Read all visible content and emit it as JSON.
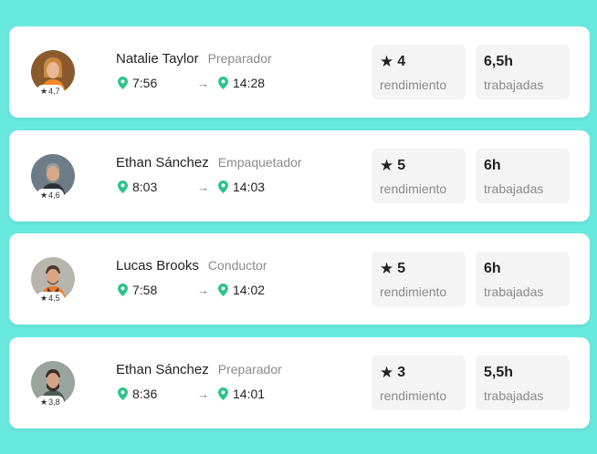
{
  "colors": {
    "background": "#69E8DE",
    "card": "#FFFFFF",
    "pin": "#2BC48A",
    "stat_bg": "#F4F4F4"
  },
  "icons": {
    "rating": "star-icon",
    "location": "map-pin-icon",
    "arrow": "arrow-right-icon"
  },
  "arrow_glyph": "→",
  "star_glyph": "★",
  "workers": [
    {
      "name": "Natalie Taylor",
      "role": "Preparador",
      "avatar_rating": "4,7",
      "start_time": "7:56",
      "end_time": "14:28",
      "performance": "4",
      "performance_label": "rendimiento",
      "hours": "6,5h",
      "hours_label": "trabajadas"
    },
    {
      "name": "Ethan Sánchez",
      "role": "Empaquetador",
      "avatar_rating": "4,6",
      "start_time": "8:03",
      "end_time": "14:03",
      "performance": "5",
      "performance_label": "rendimiento",
      "hours": "6h",
      "hours_label": "trabajadas"
    },
    {
      "name": "Lucas Brooks",
      "role": "Conductor",
      "avatar_rating": "4,5",
      "start_time": "7:58",
      "end_time": "14:02",
      "performance": "5",
      "performance_label": "rendimiento",
      "hours": "6h",
      "hours_label": "trabajadas"
    },
    {
      "name": "Ethan Sánchez",
      "role": "Preparador",
      "avatar_rating": "3,8",
      "start_time": "8:36",
      "end_time": "14:01",
      "performance": "3",
      "performance_label": "rendimiento",
      "hours": "5,5h",
      "hours_label": "trabajadas"
    }
  ]
}
